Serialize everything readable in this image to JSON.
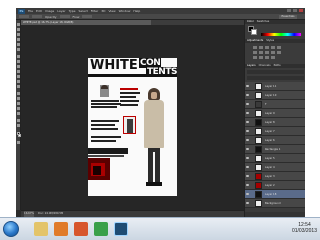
{
  "app": {
    "logo": "Ps",
    "menu": [
      "File",
      "Edit",
      "Image",
      "Layer",
      "Type",
      "Select",
      "Filter",
      "3D",
      "View",
      "Window",
      "Help"
    ],
    "options": {
      "opacity_label": "Opacity",
      "flow_label": "Flow"
    },
    "workspace": "Essentials",
    "document_tab": "WHITE.psd @ 16.7% (Layer 18, RGB/8)",
    "status": {
      "zoom": "16.67%",
      "doc_info": "Doc: 24.9M/280.5M"
    }
  },
  "document": {
    "headline_1": "WHITE",
    "headline_2a": "CON",
    "headline_2b": "TENTS"
  },
  "panels": {
    "top_tabs": [
      "Color",
      "Swatches"
    ],
    "adjustments_tabs": [
      "Adjustments",
      "Styles"
    ],
    "layers_tabs": [
      "Layers",
      "Channels",
      "Paths"
    ],
    "layers": [
      {
        "name": "Layer 11",
        "thumb": "white"
      },
      {
        "name": "Layer 10",
        "thumb": "white"
      },
      {
        "name": "T",
        "thumb": "t"
      },
      {
        "name": "Layer 9",
        "thumb": "white"
      },
      {
        "name": "Layer 8",
        "thumb": "dark"
      },
      {
        "name": "Layer 7",
        "thumb": "white"
      },
      {
        "name": "Layer 6",
        "thumb": "white"
      },
      {
        "name": "Rectangle 1",
        "thumb": "dark"
      },
      {
        "name": "Layer 5",
        "thumb": "white"
      },
      {
        "name": "Layer 4",
        "thumb": "white"
      },
      {
        "name": "Layer 3",
        "thumb": "red"
      },
      {
        "name": "Layer 2",
        "thumb": "red"
      },
      {
        "name": "Layer 18",
        "thumb": "dark"
      },
      {
        "name": "Background",
        "thumb": "white"
      }
    ]
  },
  "taskbar": {
    "time": "12:54",
    "date": "01/03/2013"
  },
  "colors": {
    "ps_bg": "#2b2b2b",
    "panel": "#3b3b3b",
    "taskbar": "#cbd6e2"
  }
}
